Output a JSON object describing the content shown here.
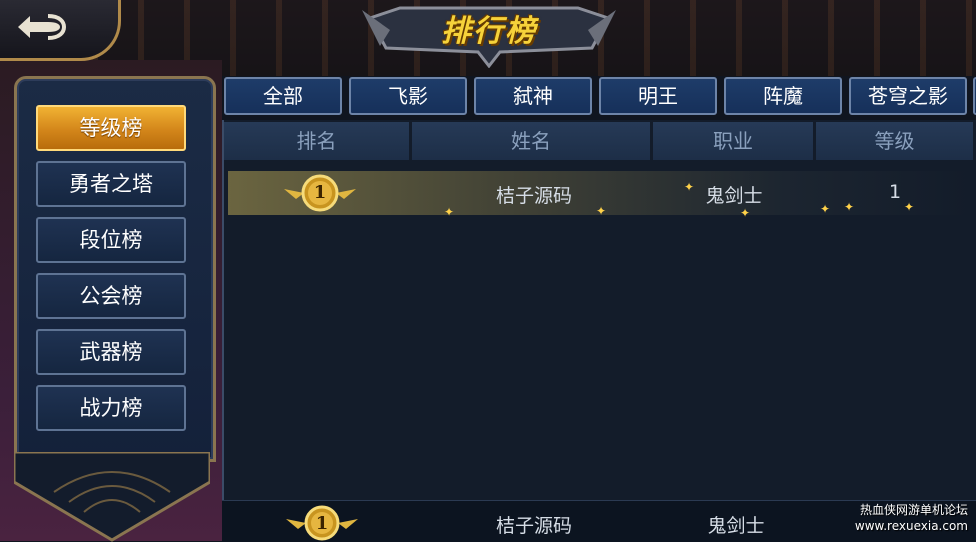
{
  "title": "排行榜",
  "categories": [
    "等级榜",
    "勇者之塔",
    "段位榜",
    "公会榜",
    "武器榜",
    "战力榜"
  ],
  "active_category": "等级榜",
  "tabs": [
    "全部",
    "飞影",
    "弑神",
    "明王",
    "阵魔",
    "苍穹之影"
  ],
  "columns": [
    "排名",
    "姓名",
    "职业",
    "等级"
  ],
  "rows": [
    {
      "rank": "1",
      "name": "桔子源码",
      "class": "鬼剑士",
      "level": "1"
    }
  ],
  "self_row": {
    "rank": "1",
    "name": "桔子源码",
    "class": "鬼剑士"
  },
  "watermark": {
    "line1": "热血侠网游单机论坛",
    "line2": "www.rexuexia.com"
  },
  "icons": {
    "back": "back-arrow-icon",
    "medal": "rank-medal-icon"
  },
  "colors": {
    "accent": "#f1b233",
    "tab_bg": "#1e3c69",
    "panel_border": "#8a7550"
  }
}
